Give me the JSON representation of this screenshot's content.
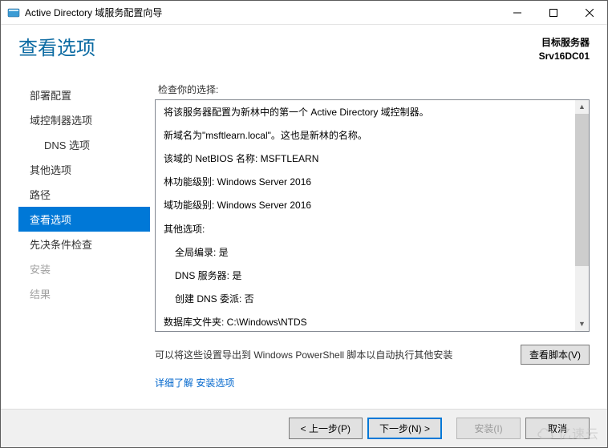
{
  "window_title": "Active Directory 域服务配置向导",
  "header": {
    "heading": "查看选项",
    "target_label": "目标服务器",
    "target_server": "Srv16DC01"
  },
  "sidebar": {
    "items": [
      {
        "label": "部署配置",
        "name": "deployment-config"
      },
      {
        "label": "域控制器选项",
        "name": "dc-options"
      },
      {
        "label": "DNS 选项",
        "name": "dns-options",
        "sub": true
      },
      {
        "label": "其他选项",
        "name": "additional-options"
      },
      {
        "label": "路径",
        "name": "paths"
      },
      {
        "label": "查看选项",
        "name": "review-options",
        "selected": true
      },
      {
        "label": "先决条件检查",
        "name": "prereq-check"
      },
      {
        "label": "安装",
        "name": "installation",
        "disabled": true
      },
      {
        "label": "结果",
        "name": "results",
        "disabled": true
      }
    ]
  },
  "main": {
    "prompt": "检查你的选择:",
    "review_lines": [
      {
        "text": "将该服务器配置为新林中的第一个 Active Directory 域控制器。",
        "type": "line"
      },
      {
        "text": "新域名为\"msftlearn.local\"。这也是新林的名称。",
        "type": "line"
      },
      {
        "text": "该域的 NetBIOS 名称: MSFTLEARN",
        "type": "line"
      },
      {
        "text": "林功能级别: Windows Server 2016",
        "type": "line"
      },
      {
        "text": "域功能级别: Windows Server 2016",
        "type": "line"
      },
      {
        "text": "其他选项:",
        "type": "line"
      },
      {
        "text": "全局编录: 是",
        "type": "sub"
      },
      {
        "text": "DNS 服务器: 是",
        "type": "sub"
      },
      {
        "text": "创建 DNS 委派: 否",
        "type": "sub"
      },
      {
        "text": "数据库文件夹: C:\\Windows\\NTDS",
        "type": "line"
      }
    ],
    "export_text": "可以将这些设置导出到 Windows PowerShell 脚本以自动执行其他安装",
    "view_script_btn": "查看脚本(V)",
    "learn_more_prefix": "详细了解",
    "learn_more_link": " 安装选项"
  },
  "footer": {
    "prev": "< 上一步(P)",
    "next": "下一步(N) >",
    "install": "安装(I)",
    "cancel": "取消"
  },
  "watermark": "亿速云"
}
